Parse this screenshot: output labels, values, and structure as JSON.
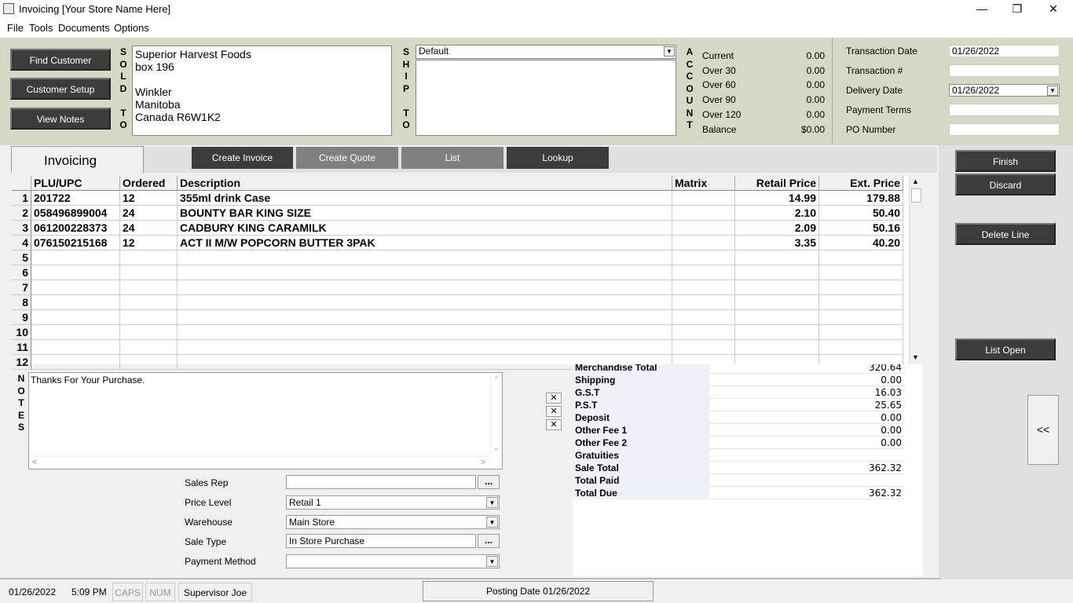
{
  "window": {
    "title": "Invoicing   [Your Store Name Here]"
  },
  "menu": [
    "File",
    "Tools",
    "Documents",
    "Options"
  ],
  "header": {
    "buttons": {
      "find_customer": "Find Customer",
      "customer_setup": "Customer Setup",
      "view_notes": "View Notes"
    },
    "sold_to_letters": [
      "S",
      "O",
      "L",
      "D",
      "",
      "T",
      "O"
    ],
    "sold_to": [
      "Superior Harvest Foods",
      "box 196",
      "",
      "Winkler",
      "Manitoba",
      "Canada R6W1K2"
    ],
    "ship_to_letters": [
      "S",
      "H",
      "I",
      "P",
      "",
      "T",
      "O"
    ],
    "ship_select": "Default",
    "account_letters": [
      "A",
      "C",
      "C",
      "O",
      "U",
      "N",
      "T"
    ],
    "account": [
      {
        "label": "Current",
        "value": "0.00"
      },
      {
        "label": "Over 30",
        "value": "0.00"
      },
      {
        "label": "Over 60",
        "value": "0.00"
      },
      {
        "label": "Over 90",
        "value": "0.00"
      },
      {
        "label": "Over 120",
        "value": "0.00"
      },
      {
        "label": "Balance",
        "value": "$0.00"
      }
    ],
    "transaction": {
      "date_label": "Transaction Date",
      "date_value": "01/26/2022",
      "num_label": "Transaction #",
      "num_value": "",
      "delivery_label": "Delivery Date",
      "delivery_value": "01/26/2022",
      "terms_label": "Payment Terms",
      "terms_value": "",
      "po_label": "PO Number",
      "po_value": ""
    }
  },
  "tabs": {
    "active": "Invoicing",
    "create_invoice": "Create Invoice",
    "create_quote": "Create Quote",
    "list": "List",
    "lookup": "Lookup"
  },
  "grid": {
    "headers": [
      "PLU/UPC",
      "Ordered",
      "Description",
      "Matrix",
      "Retail Price",
      "Ext. Price"
    ],
    "rows": [
      {
        "n": "1",
        "plu": "201722",
        "ordered": "12",
        "desc": "355ml drink Case",
        "matrix": "",
        "retail": "14.99",
        "ext": "179.88"
      },
      {
        "n": "2",
        "plu": "058496899004",
        "ordered": "24",
        "desc": "BOUNTY BAR KING SIZE",
        "matrix": "",
        "retail": "2.10",
        "ext": "50.40"
      },
      {
        "n": "3",
        "plu": "061200228373",
        "ordered": "24",
        "desc": "CADBURY KING CARAMILK",
        "matrix": "",
        "retail": "2.09",
        "ext": "50.16"
      },
      {
        "n": "4",
        "plu": "076150215168",
        "ordered": "12",
        "desc": "ACT II M/W POPCORN BUTTER 3PAK",
        "matrix": "",
        "retail": "3.35",
        "ext": "40.20"
      },
      {
        "n": "5",
        "plu": "",
        "ordered": "",
        "desc": "",
        "matrix": "",
        "retail": "",
        "ext": ""
      },
      {
        "n": "6",
        "plu": "",
        "ordered": "",
        "desc": "",
        "matrix": "",
        "retail": "",
        "ext": ""
      },
      {
        "n": "7",
        "plu": "",
        "ordered": "",
        "desc": "",
        "matrix": "",
        "retail": "",
        "ext": ""
      },
      {
        "n": "8",
        "plu": "",
        "ordered": "",
        "desc": "",
        "matrix": "",
        "retail": "",
        "ext": ""
      },
      {
        "n": "9",
        "plu": "",
        "ordered": "",
        "desc": "",
        "matrix": "",
        "retail": "",
        "ext": ""
      },
      {
        "n": "10",
        "plu": "",
        "ordered": "",
        "desc": "",
        "matrix": "",
        "retail": "",
        "ext": ""
      },
      {
        "n": "11",
        "plu": "",
        "ordered": "",
        "desc": "",
        "matrix": "",
        "retail": "",
        "ext": ""
      },
      {
        "n": "12",
        "plu": "",
        "ordered": "",
        "desc": "",
        "matrix": "",
        "retail": "",
        "ext": ""
      }
    ]
  },
  "notes": {
    "letters": [
      "N",
      "O",
      "T",
      "E",
      "S"
    ],
    "text": "Thanks For Your Purchase."
  },
  "fields": {
    "sales_rep_label": "Sales Rep",
    "sales_rep_value": "",
    "price_level_label": "Price Level",
    "price_level_value": "Retail 1",
    "warehouse_label": "Warehouse",
    "warehouse_value": "Main Store",
    "sale_type_label": "Sale Type",
    "sale_type_value": "In Store Purchase",
    "payment_method_label": "Payment Method",
    "payment_method_value": "",
    "dots": "..."
  },
  "totals": [
    {
      "label": "Merchandise Total",
      "value": "320.64"
    },
    {
      "label": "Shipping",
      "value": "0.00"
    },
    {
      "label": "G.S.T",
      "value": "16.03"
    },
    {
      "label": "P.S.T",
      "value": "25.65"
    },
    {
      "label": "Deposit",
      "value": "0.00"
    },
    {
      "label": "Other Fee 1",
      "value": "0.00"
    },
    {
      "label": "Other Fee 2",
      "value": "0.00"
    },
    {
      "label": "Gratuities",
      "value": ""
    },
    {
      "label": "Sale Total",
      "value": "362.32"
    },
    {
      "label": "Total Paid",
      "value": ""
    },
    {
      "label": "Total Due",
      "value": "362.32"
    }
  ],
  "right_buttons": {
    "finish": "Finish",
    "discard": "Discard",
    "delete_line": "Delete Line",
    "list_open": "List Open",
    "collapse": "<<"
  },
  "status": {
    "date": "01/26/2022",
    "time": "5:09 PM",
    "caps": "CAPS",
    "num": "NUM",
    "user": "Supervisor Joe",
    "posting": "Posting Date 01/26/2022"
  }
}
